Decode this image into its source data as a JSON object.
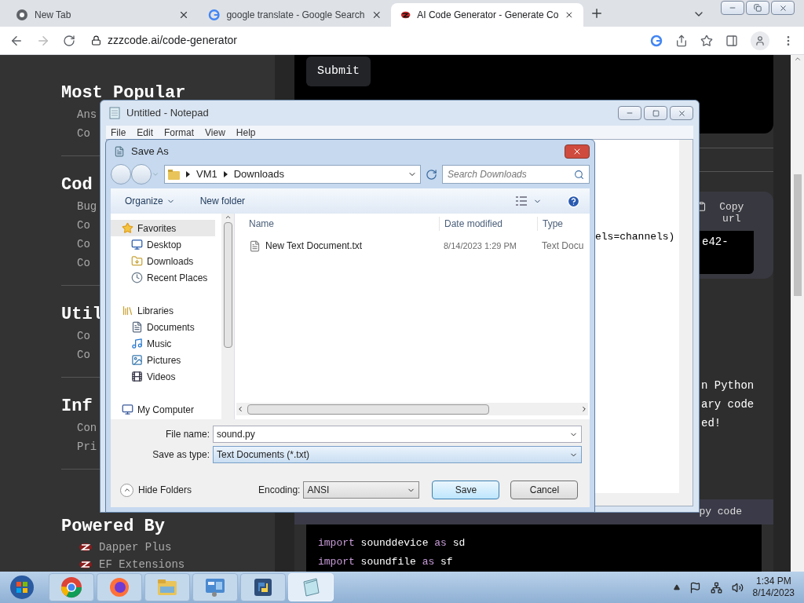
{
  "browser": {
    "tabs": [
      {
        "title": "New Tab",
        "selected": false
      },
      {
        "title": "google translate - Google Search",
        "selected": false
      },
      {
        "title": "AI Code Generator - Generate Co",
        "selected": true
      }
    ],
    "url": "zzzcode.ai/code-generator"
  },
  "sidebar": {
    "sections": [
      {
        "heading": "Most Popular",
        "items": [
          "Ans",
          "Co"
        ]
      },
      {
        "heading": "Cod",
        "items": [
          "Bug",
          "Co",
          "Co",
          "Co"
        ]
      },
      {
        "heading": "Util",
        "items": [
          "Co",
          "Co"
        ]
      },
      {
        "heading": "Inf",
        "items": [
          "Con",
          "Pri"
        ]
      }
    ],
    "powered_by": {
      "heading": "Powered By",
      "items": [
        "Dapper Plus",
        "EF Extensions"
      ]
    }
  },
  "main": {
    "submit": "Submit",
    "copy_url": "Copy url",
    "url_fragment": "e42-",
    "text_lines": [
      "n Python",
      "ary code",
      "ed!"
    ],
    "copy_code": "py code",
    "code_lines": [
      [
        {
          "t": "import",
          "kind": "keyword"
        },
        {
          "t": " sounddevice ",
          "kind": "plain"
        },
        {
          "t": "as",
          "kind": "keyword"
        },
        {
          "t": " sd",
          "kind": "plain"
        }
      ],
      [
        {
          "t": "import",
          "kind": "keyword"
        },
        {
          "t": " soundfile ",
          "kind": "plain"
        },
        {
          "t": "as",
          "kind": "keyword"
        },
        {
          "t": " sf",
          "kind": "plain"
        }
      ]
    ]
  },
  "notepad": {
    "title": "Untitled - Notepad",
    "menu": [
      "File",
      "Edit",
      "Format",
      "View",
      "Help"
    ],
    "text": "els=channels)"
  },
  "save_as": {
    "title": "Save As",
    "path": [
      "VM1",
      "Downloads"
    ],
    "search": {
      "placeholder": "Search Downloads"
    },
    "toolbar": [
      "Organize",
      "New folder"
    ],
    "nav": [
      {
        "label": "Favorites",
        "kind": "group",
        "selected": true
      },
      {
        "label": "Desktop",
        "kind": "item",
        "selected": false
      },
      {
        "label": "Downloads",
        "kind": "item",
        "selected": false
      },
      {
        "label": "Recent Places",
        "kind": "item",
        "selected": false
      },
      {
        "label": "Libraries",
        "kind": "group",
        "selected": false
      },
      {
        "label": "Documents",
        "kind": "item",
        "selected": false
      },
      {
        "label": "Music",
        "kind": "item",
        "selected": false
      },
      {
        "label": "Pictures",
        "kind": "item",
        "selected": false
      },
      {
        "label": "Videos",
        "kind": "item",
        "selected": false
      },
      {
        "label": "My Computer",
        "kind": "group",
        "selected": false
      }
    ],
    "columns": [
      "Name",
      "Date modified",
      "Type"
    ],
    "files": [
      {
        "name": "New Text Document.txt",
        "date": "8/14/2023 1:29 PM",
        "type": "Text Docu"
      }
    ],
    "file_name_label": "File name:",
    "file_name": "sound.py",
    "type_label": "Save as type:",
    "type_value": "Text Documents (*.txt)",
    "hide_folders": "Hide Folders",
    "encoding_label": "Encoding:",
    "encoding": "ANSI",
    "buttons": [
      "Save",
      "Cancel"
    ]
  },
  "taskbar": {
    "apps": [
      {
        "selected": false
      },
      {
        "selected": false
      },
      {
        "selected": false
      },
      {
        "selected": false
      },
      {
        "selected": false
      },
      {
        "selected": true
      }
    ],
    "time": "1:34 PM",
    "date": "8/14/2023"
  }
}
